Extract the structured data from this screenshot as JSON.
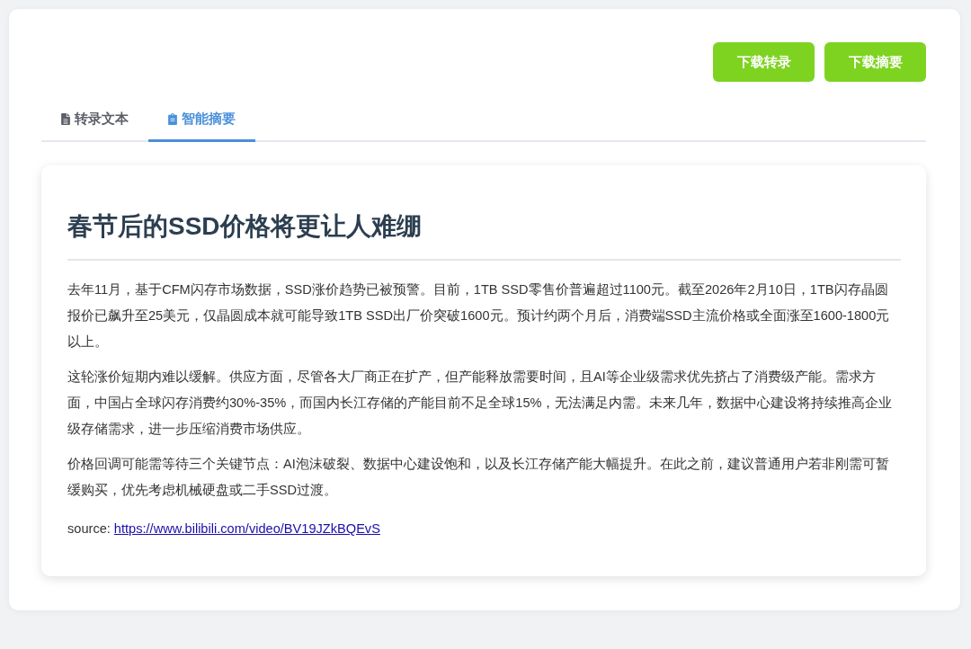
{
  "actions": [
    {
      "label": "下载转录"
    },
    {
      "label": "下载摘要"
    }
  ],
  "tabs": [
    {
      "label": "转录文本",
      "selected": false
    },
    {
      "label": "智能摘要",
      "selected": true
    }
  ],
  "summary": {
    "title": "春节后的SSD价格将更让人难绷",
    "paragraphs": [
      "去年11月，基于CFM闪存市场数据，SSD涨价趋势已被预警。目前，1TB SSD零售价普遍超过1100元。截至2026年2月10日，1TB闪存晶圆报价已飙升至25美元，仅晶圆成本就可能导致1TB SSD出厂价突破1600元。预计约两个月后，消费端SSD主流价格或全面涨至1600-1800元以上。",
      "这轮涨价短期内难以缓解。供应方面，尽管各大厂商正在扩产，但产能释放需要时间，且AI等企业级需求优先挤占了消费级产能。需求方面，中国占全球闪存消费约30%-35%，而国内长江存储的产能目前不足全球15%，无法满足内需。未来几年，数据中心建设将持续推高企业级存储需求，进一步压缩消费市场供应。",
      "价格回调可能需等待三个关键节点：AI泡沫破裂、数据中心建设饱和，以及长江存储产能大幅提升。在此之前，建议普通用户若非刚需可暂缓购买，优先考虑机械硬盘或二手SSD过渡。"
    ],
    "source": {
      "label": "source:",
      "url": "https://www.bilibili.com/video/BV19JZkBQEvS"
    }
  }
}
